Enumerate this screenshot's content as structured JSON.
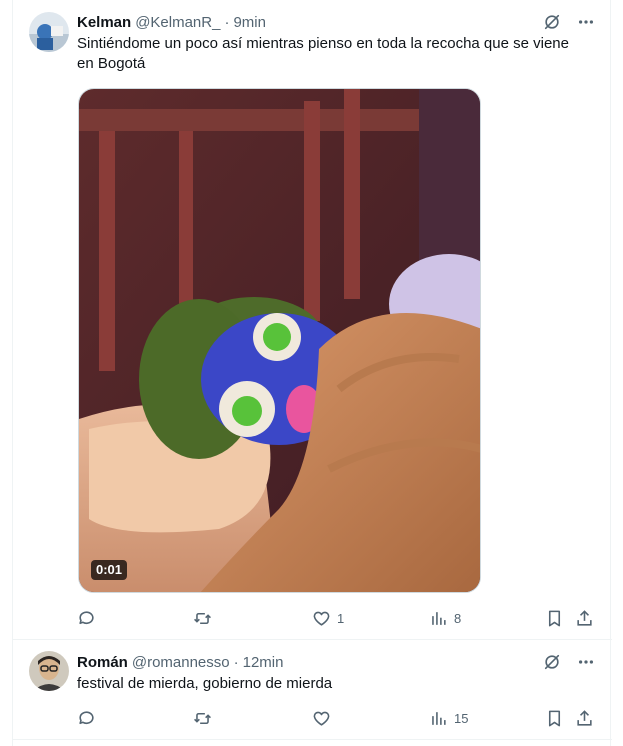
{
  "tweets": [
    {
      "name": "Kelman",
      "handle": "@KelmanR_",
      "dot": "·",
      "time": "9min",
      "text": "Sintiéndome un poco así mientras pienso en toda la recocha que se viene en Bogotá",
      "video_duration": "0:01",
      "actions": {
        "reply": "",
        "retweet": "",
        "like": "1",
        "views": "8"
      }
    },
    {
      "name": "Román",
      "handle": "@romannesso",
      "dot": "·",
      "time": "12min",
      "text": "festival de mierda, gobierno de mierda",
      "actions": {
        "reply": "",
        "retweet": "",
        "like": "",
        "views": "15"
      }
    }
  ],
  "colors": {
    "text": "#0f1419",
    "secondary": "#536471",
    "border": "#eff3f4"
  },
  "icons": [
    "grok-icon",
    "more-icon",
    "reply-icon",
    "retweet-icon",
    "like-icon",
    "views-icon",
    "bookmark-icon",
    "share-icon"
  ]
}
